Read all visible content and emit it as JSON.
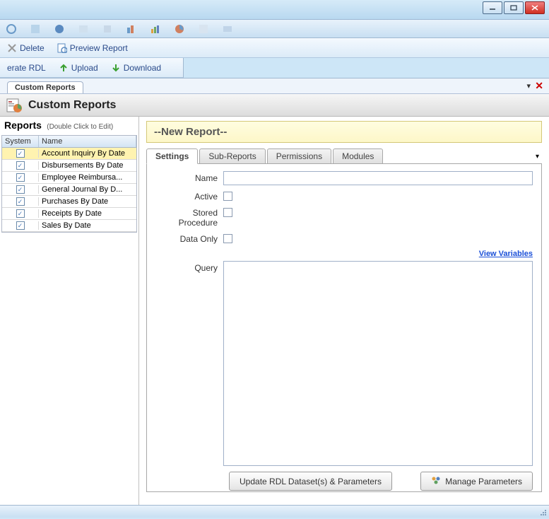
{
  "toolbar1": {
    "delete": "Delete",
    "preview": "Preview Report"
  },
  "toolbar2": {
    "generate_rdl": "erate RDL",
    "upload": "Upload",
    "download": "Download"
  },
  "doc_tab": "Custom Reports",
  "panel_title": "Custom Reports",
  "reports_header": {
    "title": "Reports",
    "hint": "(Double Click to Edit)"
  },
  "grid": {
    "columns": {
      "system": "System",
      "name": "Name"
    },
    "rows": [
      {
        "system": true,
        "name": "Account Inquiry By Date",
        "selected": true
      },
      {
        "system": true,
        "name": "Disbursements By Date"
      },
      {
        "system": true,
        "name": "Employee Reimbursa..."
      },
      {
        "system": true,
        "name": "General Journal By D..."
      },
      {
        "system": true,
        "name": "Purchases By Date"
      },
      {
        "system": true,
        "name": "Receipts By Date"
      },
      {
        "system": true,
        "name": "Sales By Date"
      }
    ]
  },
  "report_title": "--New Report--",
  "tabs": {
    "settings": "Settings",
    "sub_reports": "Sub-Reports",
    "permissions": "Permissions",
    "modules": "Modules"
  },
  "form": {
    "name_label": "Name",
    "name_value": "",
    "active_label": "Active",
    "stored_proc_label": "Stored Procedure",
    "data_only_label": "Data Only",
    "query_label": "Query",
    "query_value": "",
    "view_variables": "View Variables"
  },
  "buttons": {
    "update_rdl": "Update RDL Dataset(s) & Parameters",
    "manage_params": "Manage Parameters"
  }
}
